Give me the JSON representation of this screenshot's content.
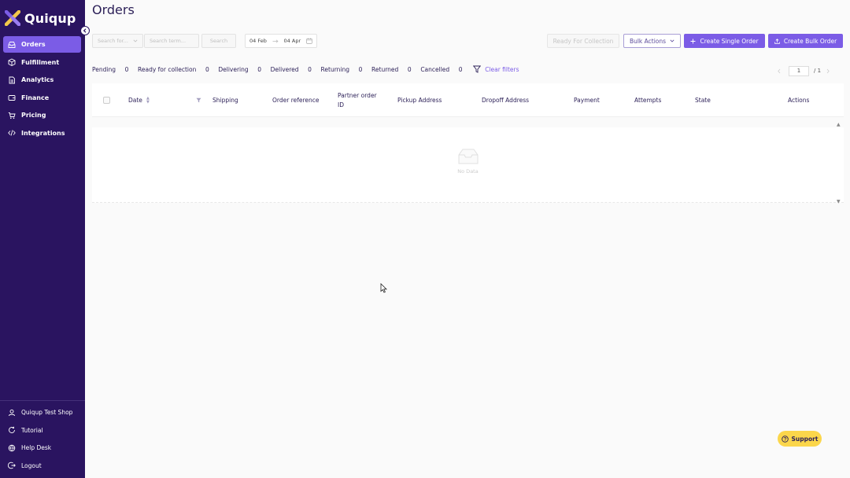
{
  "brand": {
    "name": "Quiqup",
    "accent": "#7b5ce6",
    "sidebar_bg": "#2a1460"
  },
  "sidebar": {
    "items": [
      {
        "label": "Orders",
        "icon": "inbox-icon",
        "active": true
      },
      {
        "label": "Fulfillment",
        "icon": "box-icon"
      },
      {
        "label": "Analytics",
        "icon": "document-icon"
      },
      {
        "label": "Finance",
        "icon": "wallet-icon"
      },
      {
        "label": "Pricing",
        "icon": "cart-icon"
      },
      {
        "label": "Integrations",
        "icon": "code-icon"
      }
    ],
    "bottom_items": [
      {
        "label": "Quiqup Test Shop",
        "icon": "user-icon"
      },
      {
        "label": "Tutorial",
        "icon": "refresh-icon"
      },
      {
        "label": "Help Desk",
        "icon": "globe-icon"
      },
      {
        "label": "Logout",
        "icon": "logout-icon"
      }
    ]
  },
  "header": {
    "title": "Orders"
  },
  "filters": {
    "search_for_placeholder": "Search for...",
    "search_term_placeholder": "Search term...",
    "search_button": "Search",
    "date_from": "04 Feb",
    "date_to": "04 Apr"
  },
  "actions": {
    "ready_for_collection": "Ready For Collection",
    "bulk_actions": "Bulk Actions",
    "create_single": "Create Single Order",
    "create_bulk": "Create Bulk Order"
  },
  "statuses": [
    {
      "label": "Pending",
      "count": "0"
    },
    {
      "label": "Ready for collection",
      "count": "0"
    },
    {
      "label": "Delivering",
      "count": "0"
    },
    {
      "label": "Delivered",
      "count": "0"
    },
    {
      "label": "Returning",
      "count": "0"
    },
    {
      "label": "Returned",
      "count": "0"
    },
    {
      "label": "Cancelled",
      "count": "0"
    }
  ],
  "clear_filters": "Clear filters",
  "pagination": {
    "current": "1",
    "total": "/ 1"
  },
  "table": {
    "columns": [
      "Date",
      "Shipping",
      "Order reference",
      "Partner order ID",
      "Pickup Address",
      "Dropoff Address",
      "Payment",
      "Attempts",
      "State",
      "Actions"
    ],
    "empty_text": "No Data"
  },
  "support": {
    "label": "Support"
  }
}
